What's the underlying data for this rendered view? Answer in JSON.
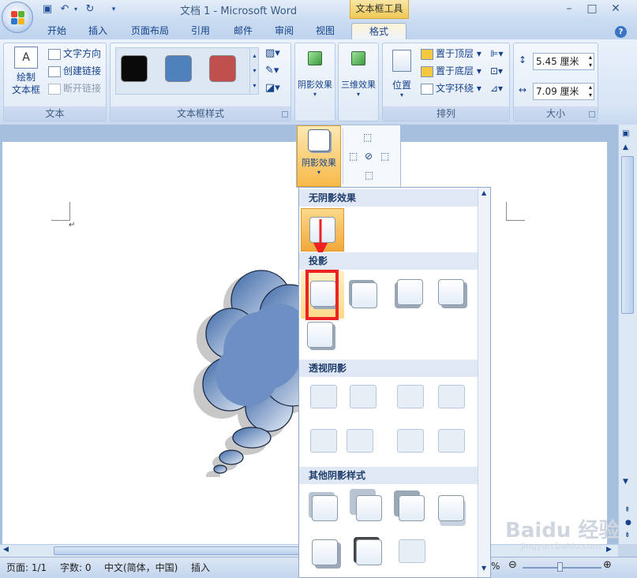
{
  "title_bar": {
    "window_title": "文档 1 - Microsoft Word",
    "context_tab": "文本框工具",
    "minimize": "–",
    "restore": "□",
    "close": "✕"
  },
  "tabs": [
    {
      "label": "开始"
    },
    {
      "label": "插入"
    },
    {
      "label": "页面布局"
    },
    {
      "label": "引用"
    },
    {
      "label": "邮件"
    },
    {
      "label": "审阅"
    },
    {
      "label": "视图"
    },
    {
      "label": "格式",
      "active": true
    }
  ],
  "help": "?",
  "ribbon": {
    "text_group": {
      "label": "文本",
      "draw_textbox": "绘制\n文本框",
      "text_direction": "文字方向",
      "create_link": "创建链接",
      "break_link": "断开链接"
    },
    "styles_group": {
      "label": "文本框样式",
      "swatches": [
        "#0a0a0a",
        "#4f81bd",
        "#c0504d"
      ]
    },
    "shadow_button": "阴影效果",
    "three_d_button": "三维效果",
    "arrange_group": {
      "label": "排列",
      "position": "位置",
      "bring_front": "置于顶层",
      "send_back": "置于底层",
      "text_wrap": "文字环绕"
    },
    "size_group": {
      "label": "大小",
      "height": "5.45 厘米",
      "width": "7.09 厘米"
    }
  },
  "shadow_menu": {
    "dropdown_label": "阴影效果",
    "sections": [
      "无阴影效果",
      "投影",
      "透视阴影",
      "其他阴影样式"
    ]
  },
  "status": {
    "page": "页面: 1/1",
    "words": "字数: 0",
    "language": "中文(简体，中国)",
    "mode": "插入",
    "zoom": "%"
  },
  "watermark": "Baidu 经验",
  "watermark_sub": "jingyan.baidu.com",
  "colors": {
    "accent": "#f0c955",
    "highlight": "#ee2222",
    "cloud": "#6d8fc4"
  }
}
